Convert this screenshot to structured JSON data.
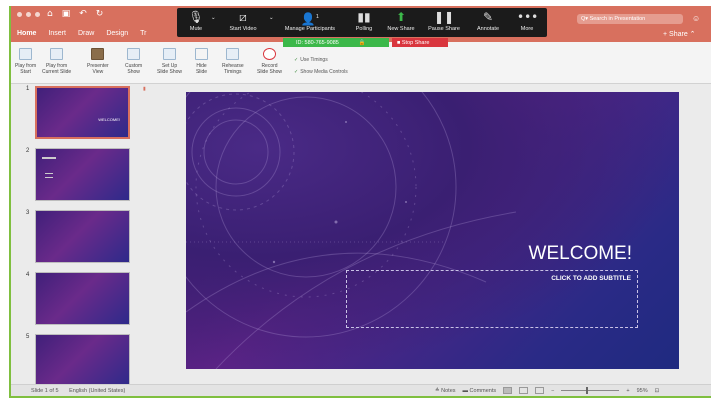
{
  "titlebar": {
    "menu_tabs": [
      "Home",
      "Insert",
      "Draw",
      "Design",
      "Tr"
    ],
    "active_tab": "Home",
    "search_placeholder": "Search in Presentation",
    "share_label": "Share"
  },
  "zoom_toolbar": {
    "mute": "Mute",
    "start_video": "Start Video",
    "manage_participants": "Manage Participants",
    "participant_count": "1",
    "polling": "Polling",
    "new_share": "New Share",
    "pause_share": "Pause Share",
    "annotate": "Annotate",
    "more": "More",
    "meeting_id": "ID: 580-765-9085",
    "stop_share": "Stop Share"
  },
  "ribbon": {
    "play_from_start": [
      "Play from",
      "Start"
    ],
    "play_from_current": [
      "Play from",
      "Current Slide"
    ],
    "presenter_view": [
      "Presenter",
      "View"
    ],
    "custom_show": [
      "Custom",
      "Show"
    ],
    "set_up_slide_show": [
      "Set Up",
      "Slide Show"
    ],
    "hide_slide": [
      "Hide",
      "Slide"
    ],
    "rehearse_timings": [
      "Rehearse",
      "Timings"
    ],
    "record_slide_show": [
      "Record",
      "Slide Show"
    ],
    "use_timings": "Use Timings",
    "show_media_controls": "Show Media Controls"
  },
  "thumbnails": [
    {
      "number": "1",
      "text": "WELCOME!",
      "selected": true
    },
    {
      "number": "2",
      "text": "",
      "selected": false
    },
    {
      "number": "3",
      "text": "",
      "selected": false
    },
    {
      "number": "4",
      "text": "",
      "selected": false
    },
    {
      "number": "5",
      "text": "",
      "selected": false
    }
  ],
  "slide": {
    "title": "WELCOME!",
    "subtitle_placeholder": "CLICK TO ADD SUBTITLE"
  },
  "statusbar": {
    "slide_indicator": "Slide 1 of 5",
    "language": "English (United States)",
    "notes": "Notes",
    "comments": "Comments",
    "zoom": "95%",
    "zoom_fraction": 0.45
  },
  "colors": {
    "accent": "#d8705e",
    "meeting_green": "#3cb84a",
    "stop_red": "#d9363e",
    "window_border": "#7fbf3f"
  }
}
